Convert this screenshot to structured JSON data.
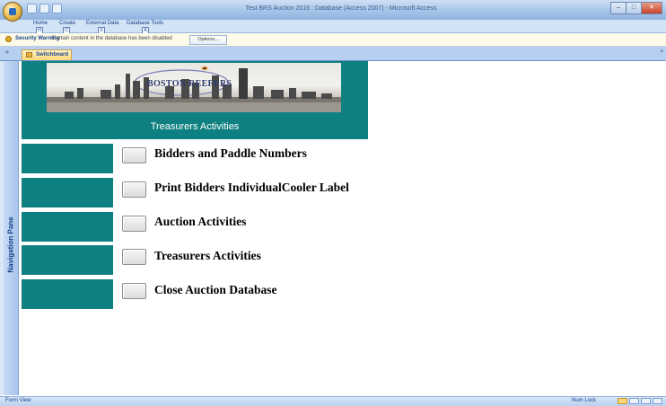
{
  "window": {
    "title": "Test BRS Auction 2016 : Database (Access 2007) - Microsoft Access",
    "controls": [
      "minimize-icon",
      "maximize-icon",
      "close-icon"
    ]
  },
  "ribbon": {
    "tabs": [
      {
        "label": "Home",
        "keytip": "H"
      },
      {
        "label": "Create",
        "keytip": "C"
      },
      {
        "label": "External Data",
        "keytip": "X"
      },
      {
        "label": "Database Tools",
        "keytip": "A"
      }
    ]
  },
  "message_bar": {
    "title": "Security Warning",
    "text": "Certain content in the database has been disabled",
    "options_label": "Options..."
  },
  "document": {
    "tab_label": "Switchboard",
    "toggle_glyph": "»"
  },
  "nav_pane": {
    "label": "Navigation Pane"
  },
  "form": {
    "logo_text": "BOSTON REEFERS",
    "header_title": "Treasurers Activities",
    "buttons": [
      {
        "label": "Bidders and Paddle Numbers"
      },
      {
        "label": "Print Bidders IndividualCooler Label"
      },
      {
        "label": "Auction Activities"
      },
      {
        "label": "Treasurers Activities"
      },
      {
        "label": "Close Auction Database"
      }
    ]
  },
  "status_bar": {
    "left": "Form View",
    "right": "Num Lock"
  },
  "colors": {
    "teal": "#0f8081",
    "ribbon_blue": "#b7cff0",
    "active_tab": "#ffd87a"
  }
}
